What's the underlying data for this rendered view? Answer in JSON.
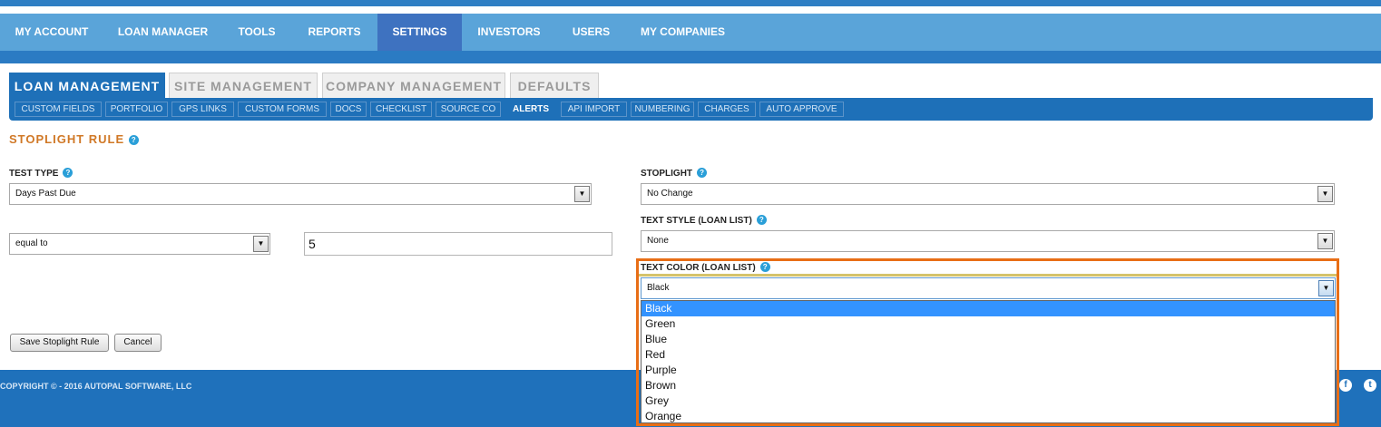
{
  "main_nav": {
    "items": [
      {
        "label": "MY ACCOUNT"
      },
      {
        "label": "LOAN MANAGER"
      },
      {
        "label": "TOOLS"
      },
      {
        "label": "REPORTS"
      },
      {
        "label": "SETTINGS",
        "active": true
      },
      {
        "label": "INVESTORS"
      },
      {
        "label": "USERS"
      },
      {
        "label": "MY COMPANIES"
      }
    ]
  },
  "tabs": [
    {
      "label": "LOAN MANAGEMENT",
      "active": true
    },
    {
      "label": "SITE MANAGEMENT"
    },
    {
      "label": "COMPANY MANAGEMENT"
    },
    {
      "label": "DEFAULTS"
    }
  ],
  "subnav": [
    {
      "label": "CUSTOM FIELDS"
    },
    {
      "label": "PORTFOLIO"
    },
    {
      "label": "GPS LINKS"
    },
    {
      "label": "CUSTOM FORMS"
    },
    {
      "label": "DOCS"
    },
    {
      "label": "CHECKLIST"
    },
    {
      "label": "SOURCE CO"
    },
    {
      "label": "ALERTS",
      "active": true
    },
    {
      "label": "API IMPORT"
    },
    {
      "label": "NUMBERING"
    },
    {
      "label": "CHARGES"
    },
    {
      "label": "AUTO APPROVE"
    }
  ],
  "page": {
    "title": "STOPLIGHT RULE",
    "help_glyph": "?"
  },
  "form": {
    "test_type_label": "TEST TYPE",
    "test_type_value": "Days Past Due",
    "operator_value": "equal to",
    "compare_value": "5",
    "stoplight_label": "STOPLIGHT",
    "stoplight_value": "No Change",
    "text_style_label": "TEXT STYLE (LOAN LIST)",
    "text_style_value": "None",
    "text_color_label": "TEXT COLOR (LOAN LIST)",
    "text_color_value": "Black",
    "text_color_options": [
      "Black",
      "Green",
      "Blue",
      "Red",
      "Purple",
      "Brown",
      "Grey",
      "Orange"
    ],
    "save_label": "Save Stoplight Rule",
    "cancel_label": "Cancel"
  },
  "footer": {
    "copyright": "COPYRIGHT © - 2016 AUTOPAL SOFTWARE, LLC",
    "facebook_glyph": "f",
    "twitter_glyph": "t"
  },
  "colors": {
    "nav_bg": "#5aa4d9",
    "nav_active": "#3e72c0",
    "tab_active": "#1e70b8",
    "title_orange": "#d07826",
    "highlight_border": "#e86e16",
    "option_selected": "#3393ff"
  },
  "icons": {
    "select_arrow": "▼"
  }
}
